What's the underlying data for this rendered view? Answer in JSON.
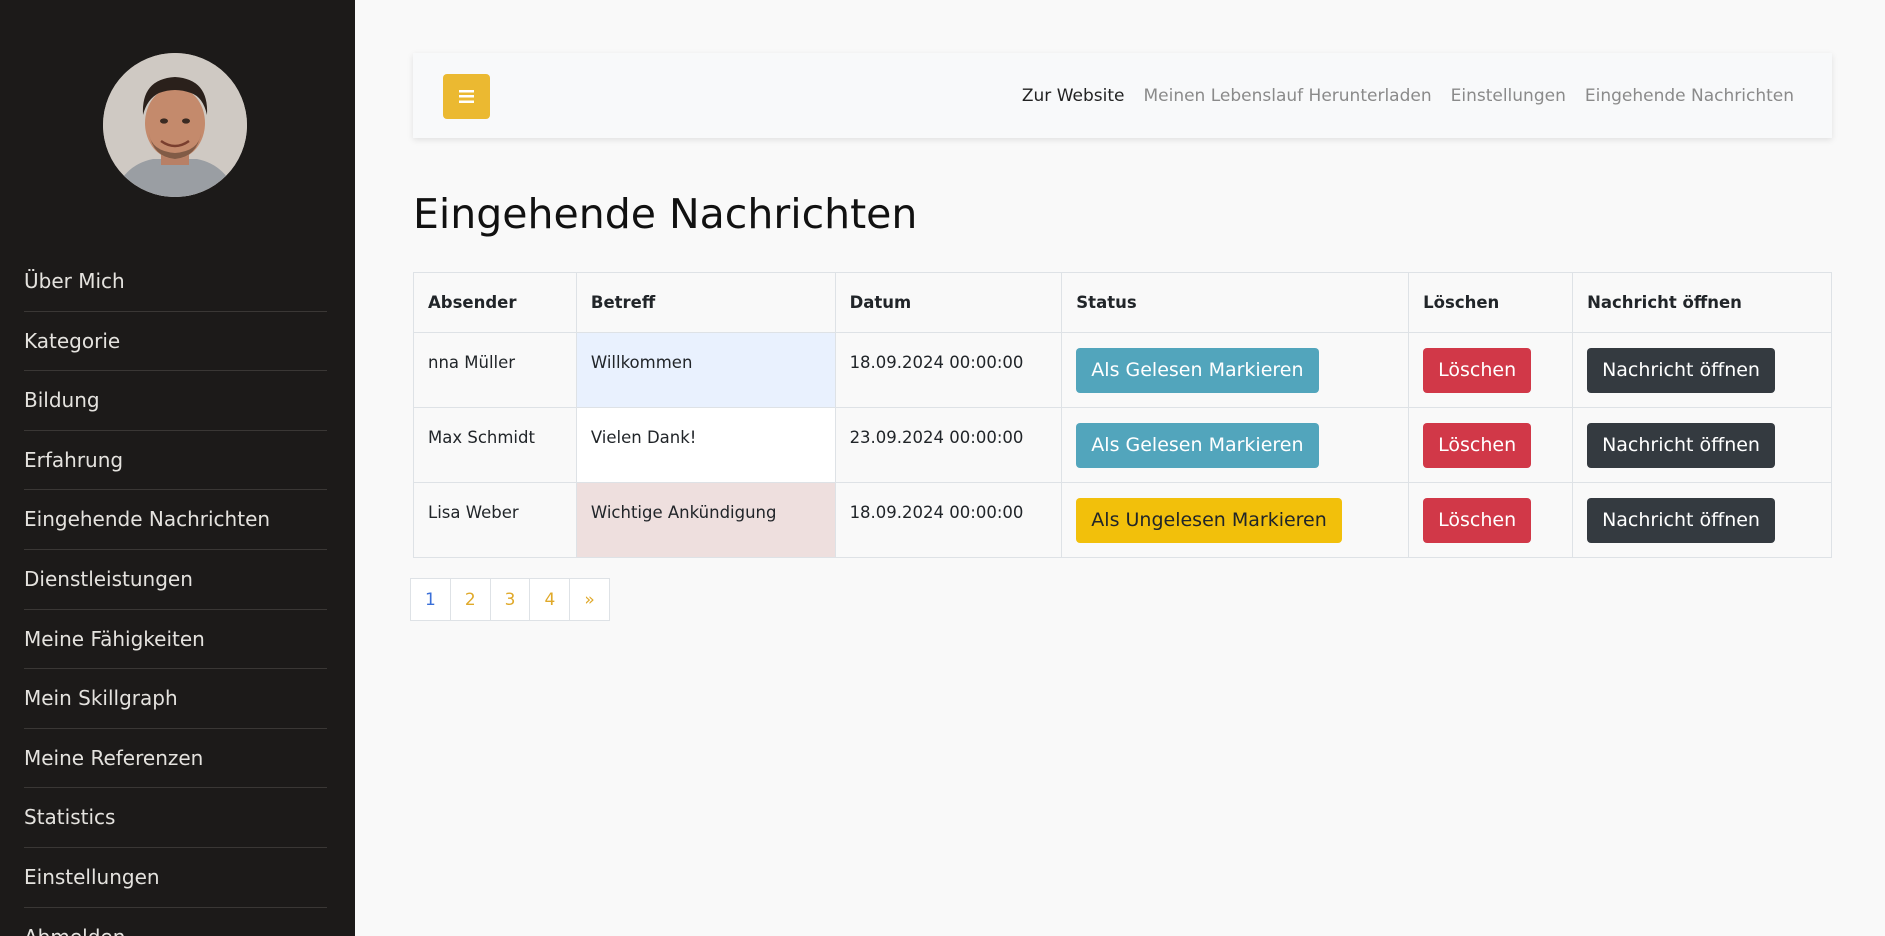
{
  "sidebar": {
    "items": [
      {
        "label": "Über Mich"
      },
      {
        "label": "Kategorie"
      },
      {
        "label": "Bildung"
      },
      {
        "label": "Erfahrung"
      },
      {
        "label": "Eingehende Nachrichten"
      },
      {
        "label": "Dienstleistungen"
      },
      {
        "label": "Meine Fähigkeiten"
      },
      {
        "label": "Mein Skillgraph"
      },
      {
        "label": "Meine Referenzen"
      },
      {
        "label": "Statistics"
      },
      {
        "label": "Einstellungen"
      },
      {
        "label": "Abmelden"
      }
    ]
  },
  "header": {
    "menu_icon": "bars-icon",
    "links": [
      {
        "label": "Zur Website"
      },
      {
        "label": "Meinen Lebenslauf Herunterladen"
      },
      {
        "label": "Einstellungen"
      },
      {
        "label": "Eingehende Nachrichten"
      }
    ]
  },
  "main": {
    "title": "Eingehende Nachrichten",
    "columns": [
      "Absender",
      "Betreff",
      "Datum",
      "Status",
      "Löschen",
      "Nachricht öffnen"
    ],
    "rows": [
      {
        "sender": "nna Müller",
        "subject": "Willkommen",
        "date": "18.09.2024 00:00:00",
        "status_label": "Als Gelesen Markieren",
        "delete_label": "Löschen",
        "open_label": "Nachricht öffnen"
      },
      {
        "sender": "Max Schmidt",
        "subject": "Vielen Dank!",
        "date": "23.09.2024 00:00:00",
        "status_label": "Als Gelesen Markieren",
        "delete_label": "Löschen",
        "open_label": "Nachricht öffnen"
      },
      {
        "sender": "Lisa Weber",
        "subject": "Wichtige Ankündigung",
        "date": "18.09.2024 00:00:00",
        "status_label": "Als Ungelesen Markieren",
        "delete_label": "Löschen",
        "open_label": "Nachricht öffnen"
      }
    ],
    "pagination": [
      "1",
      "2",
      "3",
      "4",
      "»"
    ]
  },
  "colors": {
    "sidebar_bg": "#1c1a19",
    "accent": "#ebb931",
    "info": "#52a5bc",
    "warning": "#f2c00b",
    "danger": "#d13848",
    "dark": "#343a40"
  }
}
